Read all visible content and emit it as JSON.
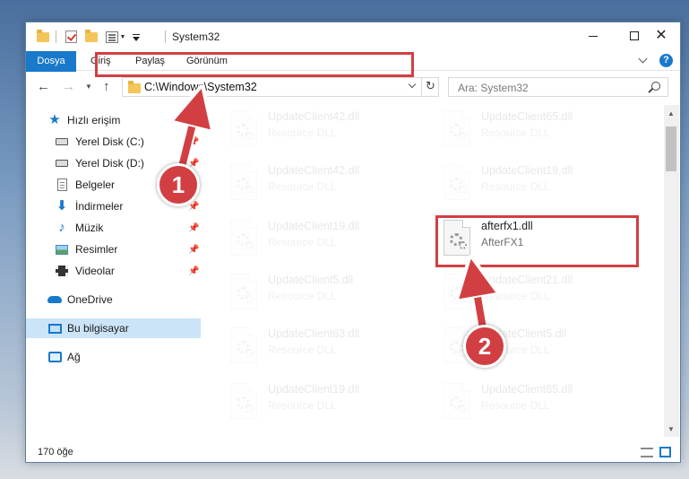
{
  "window": {
    "title": "System32",
    "accent": "#1979ca",
    "highlight_color": "#d23f43"
  },
  "ribbon": {
    "tabs": [
      "Dosya",
      "Giriş",
      "Paylaş",
      "Görünüm"
    ],
    "help_label": "?"
  },
  "navigation": {
    "address_path": "C:\\Windows\\System32",
    "search_placeholder": "Ara: System32"
  },
  "sidebar": {
    "quick_access": "Hızlı erişim",
    "items": [
      {
        "label": "Yerel Disk (C:)",
        "icon": "drive-icon"
      },
      {
        "label": "Yerel Disk (D:)",
        "icon": "drive-icon"
      },
      {
        "label": "Belgeler",
        "icon": "documents-icon"
      },
      {
        "label": "İndirmeler",
        "icon": "downloads-icon"
      },
      {
        "label": "Müzik",
        "icon": "music-icon"
      },
      {
        "label": "Resimler",
        "icon": "pictures-icon"
      },
      {
        "label": "Videolar",
        "icon": "videos-icon"
      }
    ],
    "onedrive": "OneDrive",
    "this_pc": "Bu bilgisayar",
    "network": "Ağ"
  },
  "files": [
    {
      "name": "UpdateClient42.dll",
      "description": "Resource DLL"
    },
    {
      "name": "UpdateClient65.dll",
      "description": "Resource DLL"
    },
    {
      "name": "UpdateClient42.dll",
      "description": "Resource DLL"
    },
    {
      "name": "UpdateClient19.dll",
      "description": "Resource DLL"
    },
    {
      "name": "UpdateClient19.dll",
      "description": "Resource DLL"
    },
    {
      "name": "afterfx1.dll",
      "description": "AfterFX1"
    },
    {
      "name": "UpdateClient5.dll",
      "description": "Resource DLL"
    },
    {
      "name": "UpdateClient21.dll",
      "description": "Resource DLL"
    },
    {
      "name": "UpdateClient63.dll",
      "description": "Resource DLL"
    },
    {
      "name": "UpdateClient5.dll",
      "description": "Resource DLL"
    },
    {
      "name": "UpdateClient19.dll",
      "description": "Resource DLL"
    },
    {
      "name": "UpdateClient65.dll",
      "description": "Resource DLL"
    }
  ],
  "status": {
    "item_count": "170 öğe"
  },
  "callouts": [
    "1",
    "2"
  ]
}
